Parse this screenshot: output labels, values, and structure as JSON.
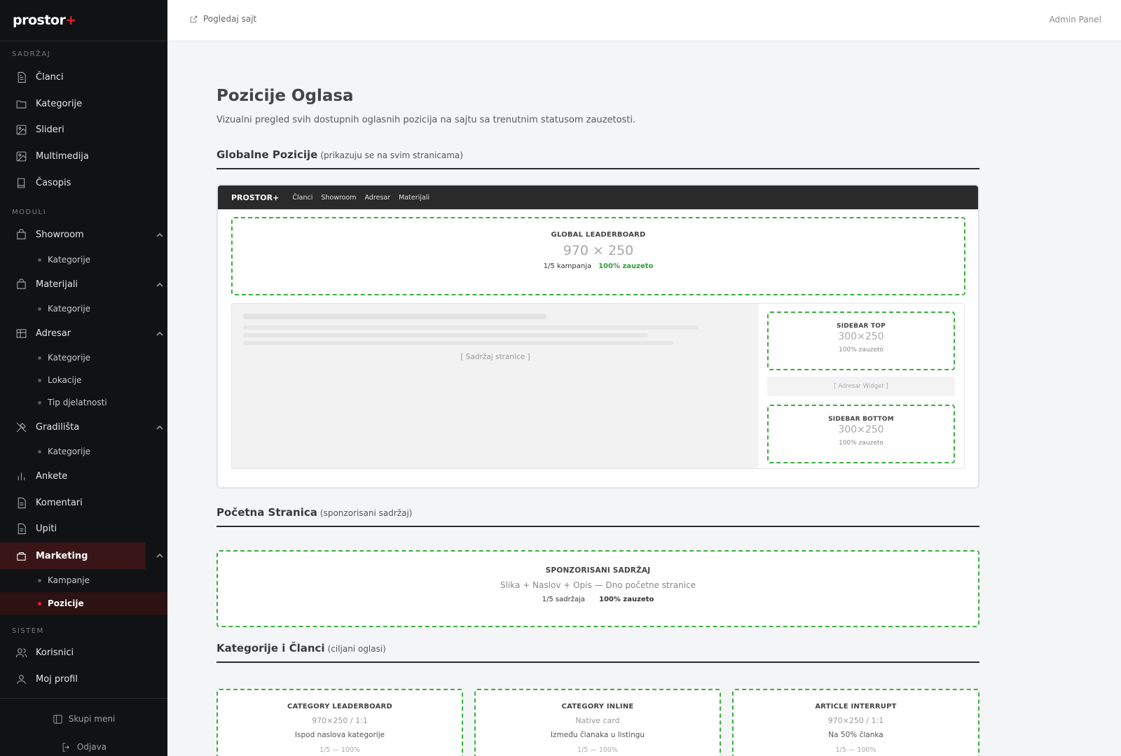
{
  "sidebar": {
    "logo": {
      "text": "prostor",
      "plus": "+"
    },
    "sections": {
      "content": "SADRŽAJ",
      "modules": "MODULI",
      "system": "SISTEM"
    },
    "items": {
      "articles": "Članci",
      "categories": "Kategorije",
      "sliders": "Slideri",
      "media": "Multimedija",
      "magazine": "Časopis",
      "showroom": "Showroom",
      "showroom_categories": "Kategorije",
      "materials": "Materijali",
      "materials_categories": "Kategorije",
      "directory": "Adresar",
      "directory_categories": "Kategorije",
      "directory_locations": "Lokacije",
      "directory_activity": "Tip djelatnosti",
      "sites": "Gradilišta",
      "sites_categories": "Kategorije",
      "polls": "Ankete",
      "comments": "Komentari",
      "inquiries": "Upiti",
      "marketing": "Marketing",
      "campaigns": "Kampanje",
      "positions": "Pozicije",
      "users": "Korisnici",
      "profile": "Moj profil"
    },
    "footer": {
      "collapse": "Skupi meni",
      "logout": "Odjava"
    }
  },
  "topbar": {
    "view_site": "Pogledaj sajt",
    "admin_panel": "Admin Panel"
  },
  "page": {
    "title": "Pozicije Oglasa",
    "description": "Vizualni pregled svih dostupnih oglasnih pozicija na sajtu sa trenutnim statusom zauzetosti."
  },
  "global_section": {
    "title": "Globalne Pozicije",
    "note": "(prikazuju se na svim stranicama)",
    "browser": {
      "brand": "PROSTOR+",
      "nav": [
        "Članci",
        "Showroom",
        "Adresar",
        "Materijali"
      ]
    },
    "leaderboard": {
      "title": "GLOBAL LEADERBOARD",
      "size": "970 × 250",
      "campaigns": "1/5 kampanja",
      "occupancy": "100% zauzeto"
    },
    "content_placeholder": "[ Sadržaj stranice ]",
    "sidebar_top": {
      "title": "SIDEBAR TOP",
      "size": "300×250",
      "occupancy": "100% zauzeto"
    },
    "widget": "[ Adresar Widget ]",
    "sidebar_bottom": {
      "title": "SIDEBAR BOTTOM",
      "size": "300×250",
      "occupancy": "100% zauzeto"
    }
  },
  "home_section": {
    "title": "Početna Stranica",
    "note": "(sponzorisani sadržaj)",
    "slot": {
      "title": "SPONZORISANI SADRŽAJ",
      "desc": "Slika + Naslov + Opis — Dno početne stranice",
      "count": "1/5 sadržaja",
      "occupancy": "100% zauzeto"
    }
  },
  "category_section": {
    "title": "Kategorije i Članci",
    "note": "(ciljani oglasi)",
    "cards": [
      {
        "title": "CATEGORY LEADERBOARD",
        "size": "970×250 / 1:1",
        "desc": "Ispod naslova kategorije",
        "stats": "1/5 — 100%"
      },
      {
        "title": "CATEGORY INLINE",
        "size": "Native card",
        "desc": "Između članaka u listingu",
        "stats": "1/5 — 100%"
      },
      {
        "title": "ARTICLE INTERRUPT",
        "size": "970×250 / 1:1",
        "desc": "Na 50% članka",
        "stats": "1/5 — 100%"
      }
    ]
  },
  "colors": {
    "accent": "#e02424",
    "slot_border": "#3cb043",
    "sidebar_bg": "#111214"
  }
}
